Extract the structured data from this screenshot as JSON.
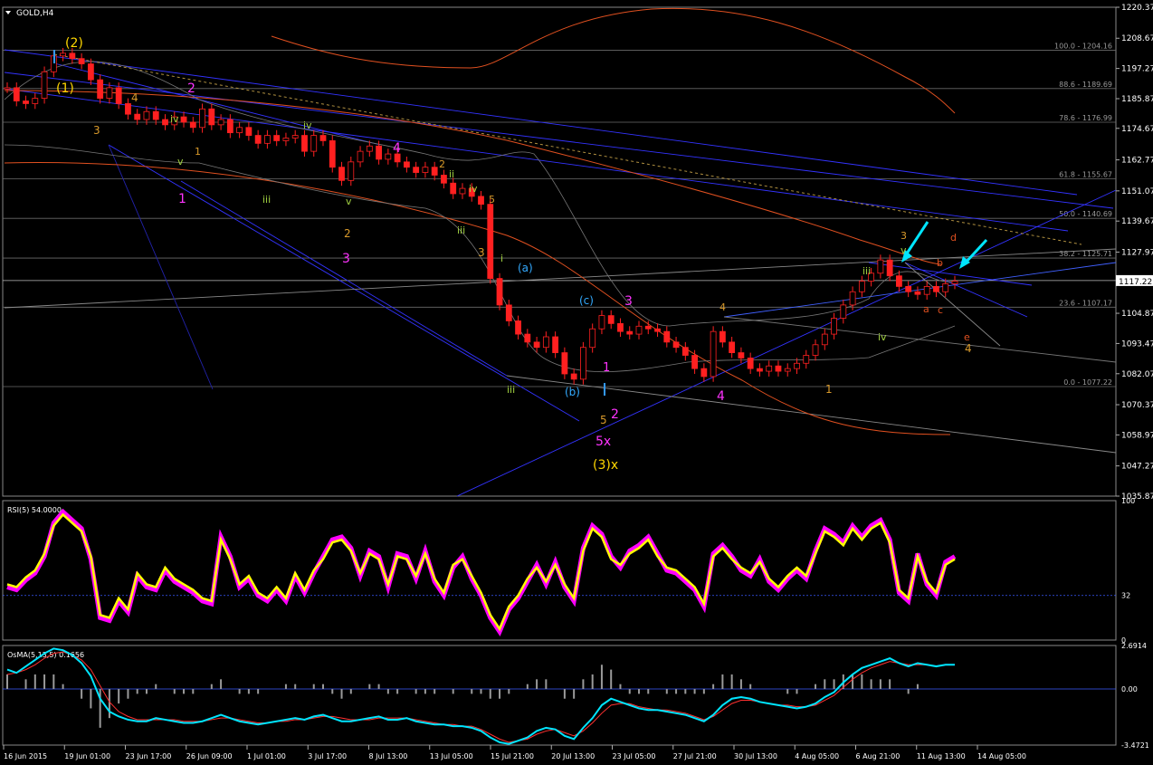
{
  "window": {
    "title": "GOLD,H4"
  },
  "chart_data": [
    {
      "type": "line",
      "name": "price",
      "ylim": [
        1035.87,
        1220.37
      ],
      "y_ticks": [
        "1220.37",
        "1208.67",
        "1197.27",
        "1185.87",
        "1174.67",
        "1162.77",
        "1151.07",
        "1139.67",
        "1127.97",
        "1117.22",
        "1104.87",
        "1093.47",
        "1082.07",
        "1070.37",
        "1058.97",
        "1047.27",
        "1035.87"
      ],
      "current_price": "1117.22",
      "x_ticks": [
        "16 Jun 2015",
        "19 Jun 01:00",
        "23 Jun 17:00",
        "26 Jun 09:00",
        "1 Jul 01:00",
        "3 Jul 17:00",
        "8 Jul 13:00",
        "13 Jul 05:00",
        "15 Jul 21:00",
        "20 Jul 13:00",
        "23 Jul 05:00",
        "27 Jul 21:00",
        "30 Jul 13:00",
        "4 Aug 05:00",
        "6 Aug 21:00",
        "11 Aug 13:00",
        "14 Aug 05:00"
      ],
      "fib_levels": [
        {
          "label": "100.0 - 1204.16",
          "value": 1204.16
        },
        {
          "label": "88.6 - 1189.69",
          "value": 1189.69
        },
        {
          "label": "78.6 - 1176.99",
          "value": 1176.99
        },
        {
          "label": "61.8 - 1155.67",
          "value": 1155.67
        },
        {
          "label": "50.0 - 1140.69",
          "value": 1140.69
        },
        {
          "label": "38.2 - 1125.71",
          "value": 1125.71
        },
        {
          "label": "23.6 - 1107.17",
          "value": 1107.17
        },
        {
          "label": "0.0 - 1077.22",
          "value": 1077.22
        }
      ],
      "series": [
        {
          "color": "#ff2020",
          "values": [
            1190,
            1185,
            1184,
            1186,
            1196,
            1202,
            1203,
            1201,
            1199,
            1193,
            1186,
            1190,
            1184,
            1180,
            1178,
            1181,
            1178,
            1176,
            1179,
            1177,
            1175,
            1182,
            1176,
            1178,
            1173,
            1175,
            1172,
            1169,
            1172,
            1170,
            1171,
            1172,
            1166,
            1172,
            1170,
            1160,
            1155,
            1162,
            1166,
            1168,
            1163,
            1165,
            1162,
            1160,
            1158,
            1160,
            1157,
            1154,
            1150,
            1152,
            1149,
            1146,
            1118,
            1108,
            1102,
            1097,
            1094,
            1092,
            1096,
            1090,
            1082,
            1080,
            1092,
            1099,
            1104,
            1101,
            1098,
            1097,
            1100,
            1099,
            1098,
            1094,
            1092,
            1089,
            1084,
            1081,
            1098,
            1094,
            1090,
            1088,
            1084,
            1083,
            1085,
            1083,
            1084,
            1086,
            1089,
            1093,
            1097,
            1103,
            1108,
            1113,
            1117,
            1120,
            1125,
            1119,
            1115,
            1113,
            1112,
            1115,
            1113,
            1116,
            1117
          ]
        }
      ]
    },
    {
      "type": "line",
      "name": "RSI",
      "title": "RSI(5) 54.0000",
      "ylim": [
        0,
        100
      ],
      "y_ticks": [
        "100",
        "32",
        "0"
      ],
      "level": 32,
      "series": [
        {
          "color": "#ffff00",
          "values": [
            40,
            38,
            45,
            50,
            62,
            82,
            90,
            84,
            78,
            60,
            18,
            16,
            30,
            22,
            48,
            40,
            38,
            52,
            44,
            40,
            36,
            30,
            28,
            72,
            58,
            40,
            46,
            34,
            30,
            38,
            30,
            48,
            36,
            50,
            58,
            70,
            72,
            64,
            48,
            62,
            58,
            40,
            60,
            58,
            46,
            62,
            44,
            34,
            54,
            58,
            46,
            34,
            18,
            8,
            24,
            32,
            44,
            52,
            42,
            54,
            40,
            30,
            64,
            80,
            74,
            58,
            54,
            62,
            66,
            72,
            60,
            52,
            50,
            44,
            38,
            26,
            60,
            66,
            58,
            52,
            48,
            56,
            44,
            38,
            46,
            52,
            46,
            62,
            78,
            74,
            68,
            80,
            72,
            80,
            84,
            70,
            36,
            30,
            60,
            42,
            34,
            54,
            58
          ]
        },
        {
          "color": "#ff00ff",
          "values": [
            38,
            36,
            43,
            48,
            60,
            84,
            92,
            86,
            80,
            58,
            16,
            14,
            28,
            20,
            46,
            38,
            36,
            50,
            42,
            38,
            34,
            28,
            26,
            74,
            60,
            38,
            44,
            32,
            28,
            36,
            28,
            46,
            34,
            48,
            60,
            72,
            74,
            66,
            46,
            64,
            60,
            38,
            62,
            60,
            44,
            64,
            42,
            32,
            52,
            60,
            44,
            32,
            16,
            6,
            22,
            30,
            42,
            54,
            40,
            56,
            38,
            28,
            66,
            82,
            76,
            60,
            52,
            64,
            68,
            74,
            62,
            50,
            48,
            42,
            36,
            24,
            62,
            68,
            60,
            50,
            46,
            58,
            42,
            36,
            44,
            50,
            44,
            64,
            80,
            76,
            70,
            82,
            74,
            82,
            86,
            72,
            34,
            28,
            62,
            40,
            32,
            56,
            60
          ]
        }
      ]
    },
    {
      "type": "line",
      "name": "OsMA",
      "title": "OsMA(5,13,5) 0.1656",
      "ylim": [
        -3.4721,
        2.6914
      ],
      "y_ticks": [
        "2.6914",
        "0.00",
        "-3.4721"
      ],
      "series": [
        {
          "color": "#00e5ff",
          "values": [
            1.2,
            1.0,
            1.4,
            1.8,
            2.2,
            2.5,
            2.4,
            2.1,
            1.6,
            0.8,
            -0.6,
            -1.4,
            -1.7,
            -1.9,
            -2.0,
            -2.0,
            -1.8,
            -1.9,
            -2.0,
            -2.1,
            -2.1,
            -2.0,
            -1.8,
            -1.6,
            -1.8,
            -2.0,
            -2.1,
            -2.2,
            -2.1,
            -2.0,
            -1.9,
            -1.8,
            -1.9,
            -1.7,
            -1.6,
            -1.8,
            -2.0,
            -2.0,
            -1.9,
            -1.8,
            -1.7,
            -1.9,
            -1.9,
            -1.8,
            -2.0,
            -2.1,
            -2.2,
            -2.2,
            -2.3,
            -2.3,
            -2.4,
            -2.6,
            -3.0,
            -3.3,
            -3.4,
            -3.2,
            -3.0,
            -2.6,
            -2.4,
            -2.5,
            -2.9,
            -3.1,
            -2.4,
            -1.8,
            -1.0,
            -0.6,
            -0.8,
            -1.0,
            -1.2,
            -1.3,
            -1.3,
            -1.4,
            -1.5,
            -1.6,
            -1.8,
            -2.0,
            -1.6,
            -1.0,
            -0.6,
            -0.5,
            -0.6,
            -0.8,
            -0.9,
            -1.0,
            -1.1,
            -1.2,
            -1.1,
            -0.9,
            -0.5,
            -0.2,
            0.4,
            0.9,
            1.3,
            1.5,
            1.7,
            1.9,
            1.6,
            1.4,
            1.6,
            1.5,
            1.4,
            1.5,
            1.5
          ]
        },
        {
          "color": "#ff3030",
          "values": [
            0.9,
            1.0,
            1.2,
            1.5,
            1.9,
            2.2,
            2.3,
            2.1,
            1.8,
            1.2,
            0.2,
            -0.8,
            -1.4,
            -1.7,
            -1.9,
            -1.9,
            -1.9,
            -1.9,
            -1.9,
            -2.0,
            -2.0,
            -2.0,
            -1.9,
            -1.8,
            -1.8,
            -1.9,
            -2.0,
            -2.1,
            -2.1,
            -2.0,
            -2.0,
            -1.9,
            -1.9,
            -1.8,
            -1.7,
            -1.7,
            -1.8,
            -1.9,
            -1.9,
            -1.9,
            -1.8,
            -1.8,
            -1.8,
            -1.8,
            -1.9,
            -2.0,
            -2.1,
            -2.2,
            -2.2,
            -2.3,
            -2.3,
            -2.5,
            -2.8,
            -3.1,
            -3.3,
            -3.2,
            -3.1,
            -2.8,
            -2.6,
            -2.5,
            -2.7,
            -2.9,
            -2.6,
            -2.1,
            -1.5,
            -1.0,
            -0.9,
            -0.9,
            -1.1,
            -1.2,
            -1.3,
            -1.3,
            -1.4,
            -1.5,
            -1.7,
            -1.9,
            -1.7,
            -1.3,
            -0.9,
            -0.7,
            -0.7,
            -0.8,
            -0.9,
            -1.0,
            -1.0,
            -1.1,
            -1.1,
            -1.0,
            -0.7,
            -0.4,
            0.1,
            0.6,
            1.0,
            1.3,
            1.5,
            1.7,
            1.6,
            1.5,
            1.5,
            1.5,
            1.4,
            1.5,
            1.5
          ]
        }
      ]
    }
  ],
  "wave_labels": [
    {
      "text": "(2)",
      "color": "#ffd700"
    },
    {
      "text": "(1)",
      "color": "#ffd700"
    },
    {
      "text": "2",
      "color": "#ff33ff"
    },
    {
      "text": "1",
      "color": "#ff33ff"
    },
    {
      "text": "3",
      "color": "#ff33ff"
    },
    {
      "text": "4",
      "color": "#ff33ff"
    },
    {
      "text": "5x",
      "color": "#ff33ff"
    },
    {
      "text": "(3)x",
      "color": "#ffd700"
    },
    {
      "text": "3",
      "color": "#ff33ff"
    },
    {
      "text": "2",
      "color": "#ff33ff"
    },
    {
      "text": "4",
      "color": "#ff33ff"
    },
    {
      "text": "1",
      "color": "#ff33ff"
    },
    {
      "text": "(a)",
      "color": "#33aaff"
    },
    {
      "text": "(b)",
      "color": "#33aaff"
    },
    {
      "text": "(c)",
      "color": "#33aaff"
    },
    {
      "text": "5",
      "color": "#d99a2b"
    },
    {
      "text": "3",
      "color": "#d99a2b"
    },
    {
      "text": "4",
      "color": "#d99a2b"
    },
    {
      "text": "1",
      "color": "#d99a2b"
    },
    {
      "text": "2",
      "color": "#d99a2b"
    },
    {
      "text": "5",
      "color": "#d99a2b"
    },
    {
      "text": "3",
      "color": "#d99a2b"
    },
    {
      "text": "4",
      "color": "#d99a2b"
    },
    {
      "text": "1",
      "color": "#d99a2b"
    },
    {
      "text": "2",
      "color": "#d99a2b"
    },
    {
      "text": "3",
      "color": "#d99a2b"
    },
    {
      "text": "4",
      "color": "#d99a2b"
    },
    {
      "text": "iii",
      "color": "#a0d040"
    },
    {
      "text": "iv",
      "color": "#a0d040"
    },
    {
      "text": "v",
      "color": "#a0d040"
    },
    {
      "text": "iii",
      "color": "#a0d040"
    },
    {
      "text": "iv",
      "color": "#a0d040"
    },
    {
      "text": "v",
      "color": "#a0d040"
    },
    {
      "text": "iii",
      "color": "#a0d040"
    },
    {
      "text": "iv",
      "color": "#a0d040"
    },
    {
      "text": "ii",
      "color": "#a0d040"
    },
    {
      "text": "i",
      "color": "#a0d040"
    },
    {
      "text": "iii",
      "color": "#a0d040"
    },
    {
      "text": "iv",
      "color": "#a0d040"
    },
    {
      "text": "v",
      "color": "#a0d040"
    },
    {
      "text": "a",
      "color": "#e05020"
    },
    {
      "text": "b",
      "color": "#e05020"
    },
    {
      "text": "c",
      "color": "#e05020"
    },
    {
      "text": "d",
      "color": "#e05020"
    },
    {
      "text": "e",
      "color": "#e05020"
    }
  ],
  "colors": {
    "background": "#000000",
    "grid": "#6a6a6a",
    "bull_candle": "#000000",
    "bear_candle": "#ff2020",
    "axis_text": "#ffffff",
    "fib_text": "#999999",
    "blue_line": "#3333ff",
    "orange_line": "#e05020",
    "cyan_arrow": "#00e5ff"
  }
}
